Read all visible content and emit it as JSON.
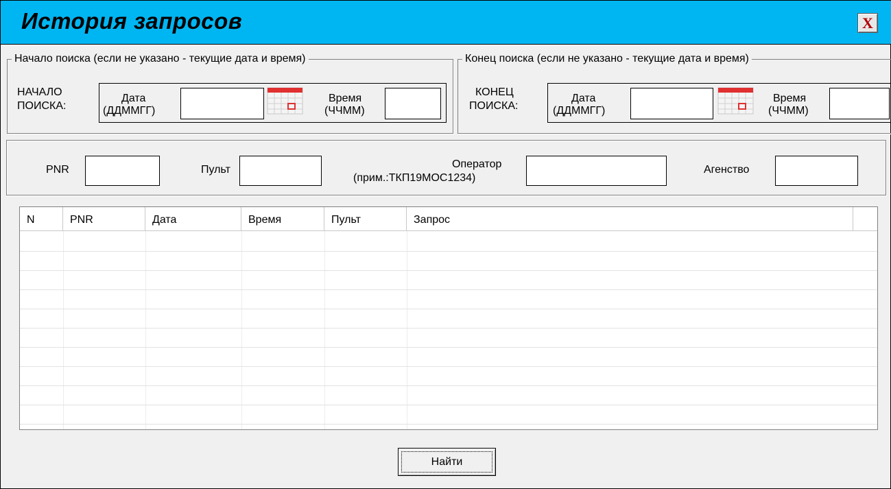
{
  "window": {
    "title": "История запросов",
    "close_icon": "X"
  },
  "start_group": {
    "legend": "Начало поиска (если не указано - текущие дата и время)",
    "label_line1": "НАЧАЛО",
    "label_line2": "ПОИСКА:",
    "date_label_line1": "Дата",
    "date_label_line2": "(ДДММГГ)",
    "date_value": "",
    "time_label_line1": "Время",
    "time_label_line2": "(ЧЧММ)",
    "time_value": ""
  },
  "end_group": {
    "legend": "Конец поиска (если не указано - текущие дата и время)",
    "label_line1": "КОНЕЦ",
    "label_line2": "ПОИСКА:",
    "date_label_line1": "Дата",
    "date_label_line2": "(ДДММГГ)",
    "date_value": "",
    "time_label_line1": "Время",
    "time_label_line2": "(ЧЧММ)",
    "time_value": ""
  },
  "filters": {
    "pnr_label": "PNR",
    "pnr_value": "",
    "pult_label": "Пульт",
    "pult_value": "",
    "operator_label_line1": "Оператор",
    "operator_label_line2": "(прим.:ТКП19МОС1234)",
    "operator_value": "",
    "agency_label": "Агенство",
    "agency_value": ""
  },
  "table": {
    "columns": [
      "N",
      "PNR",
      "Дата",
      "Время",
      "Пульт",
      "Запрос"
    ],
    "rows": []
  },
  "actions": {
    "find_label": "Найти"
  },
  "colors": {
    "titlebar": "#00b6f2",
    "calendar_accent": "#e03030"
  }
}
